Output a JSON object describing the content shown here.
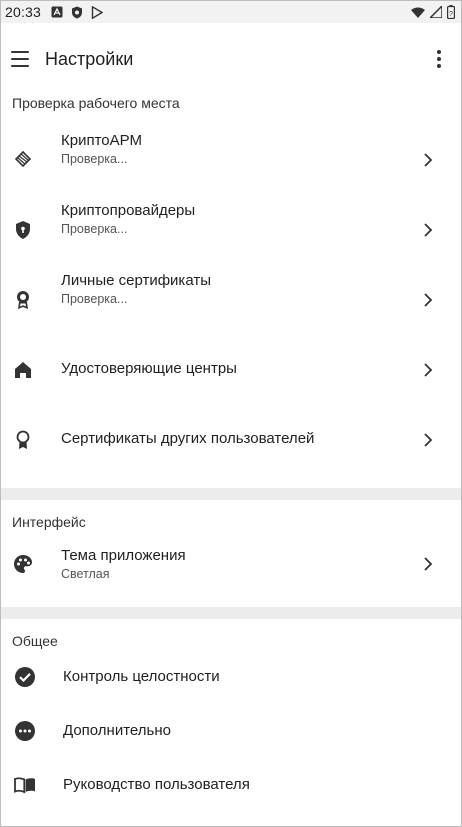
{
  "status_bar": {
    "time": "20:33",
    "left_icons": [
      "a-icon",
      "shield-icon",
      "play-icon"
    ],
    "right_icons": [
      "wifi-icon",
      "signal-icon",
      "battery-icon"
    ]
  },
  "app_bar": {
    "title": "Настройки"
  },
  "sections": [
    {
      "header": "Проверка рабочего места",
      "items": [
        {
          "title": "КриптоАРМ",
          "subtitle": "Проверка...",
          "icon": "link-diamond-icon"
        },
        {
          "title": "Криптопровайдеры",
          "subtitle": "Проверка...",
          "icon": "shield-lock-icon"
        },
        {
          "title": "Личные сертификаты",
          "subtitle": "Проверка...",
          "icon": "award-icon"
        },
        {
          "title": "Удостоверяющие центры",
          "subtitle": "",
          "icon": "home-icon"
        },
        {
          "title": "Сертификаты других пользователей",
          "subtitle": "",
          "icon": "award-outline-icon"
        }
      ]
    },
    {
      "header": "Интерфейс",
      "items": [
        {
          "title": "Тема приложения",
          "subtitle": "Светлая",
          "icon": "palette-icon"
        }
      ]
    },
    {
      "header": "Общее",
      "items": [
        {
          "title": "Контроль целостности",
          "icon": "check-circle-icon"
        },
        {
          "title": "Дополнительно",
          "icon": "more-circle-icon"
        },
        {
          "title": "Руководство пользователя",
          "icon": "book-icon"
        }
      ]
    }
  ]
}
